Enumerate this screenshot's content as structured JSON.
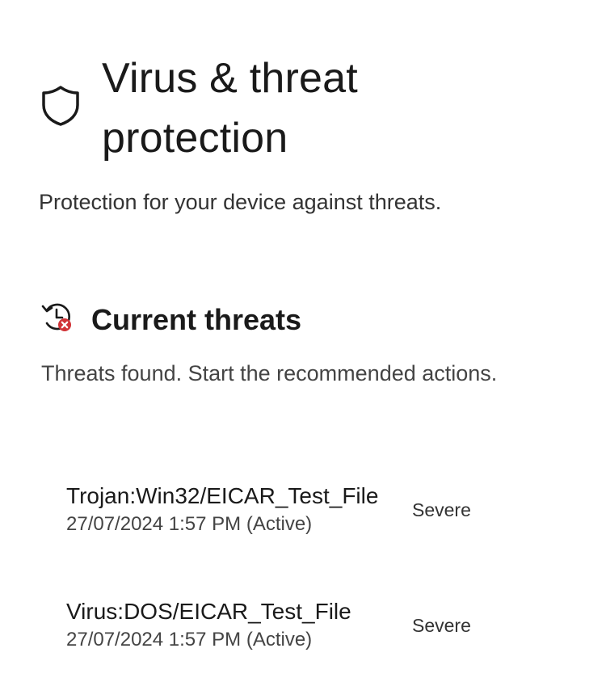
{
  "header": {
    "icon": "shield-icon",
    "title": "Virus & threat protection",
    "subtitle": "Protection for your device against threats."
  },
  "current_threats": {
    "icon": "history-icon",
    "title": "Current threats",
    "description": "Threats found. Start the recommended actions.",
    "items": [
      {
        "name": "Trojan:Win32/EICAR_Test_File",
        "timestamp": "27/07/2024 1:57 PM (Active)",
        "severity": "Severe"
      },
      {
        "name": "Virus:DOS/EICAR_Test_File",
        "timestamp": "27/07/2024 1:57 PM (Active)",
        "severity": "Severe"
      }
    ]
  },
  "colors": {
    "text": "#1a1a1a",
    "secondary_text": "#444444",
    "alert": "#d13438"
  }
}
